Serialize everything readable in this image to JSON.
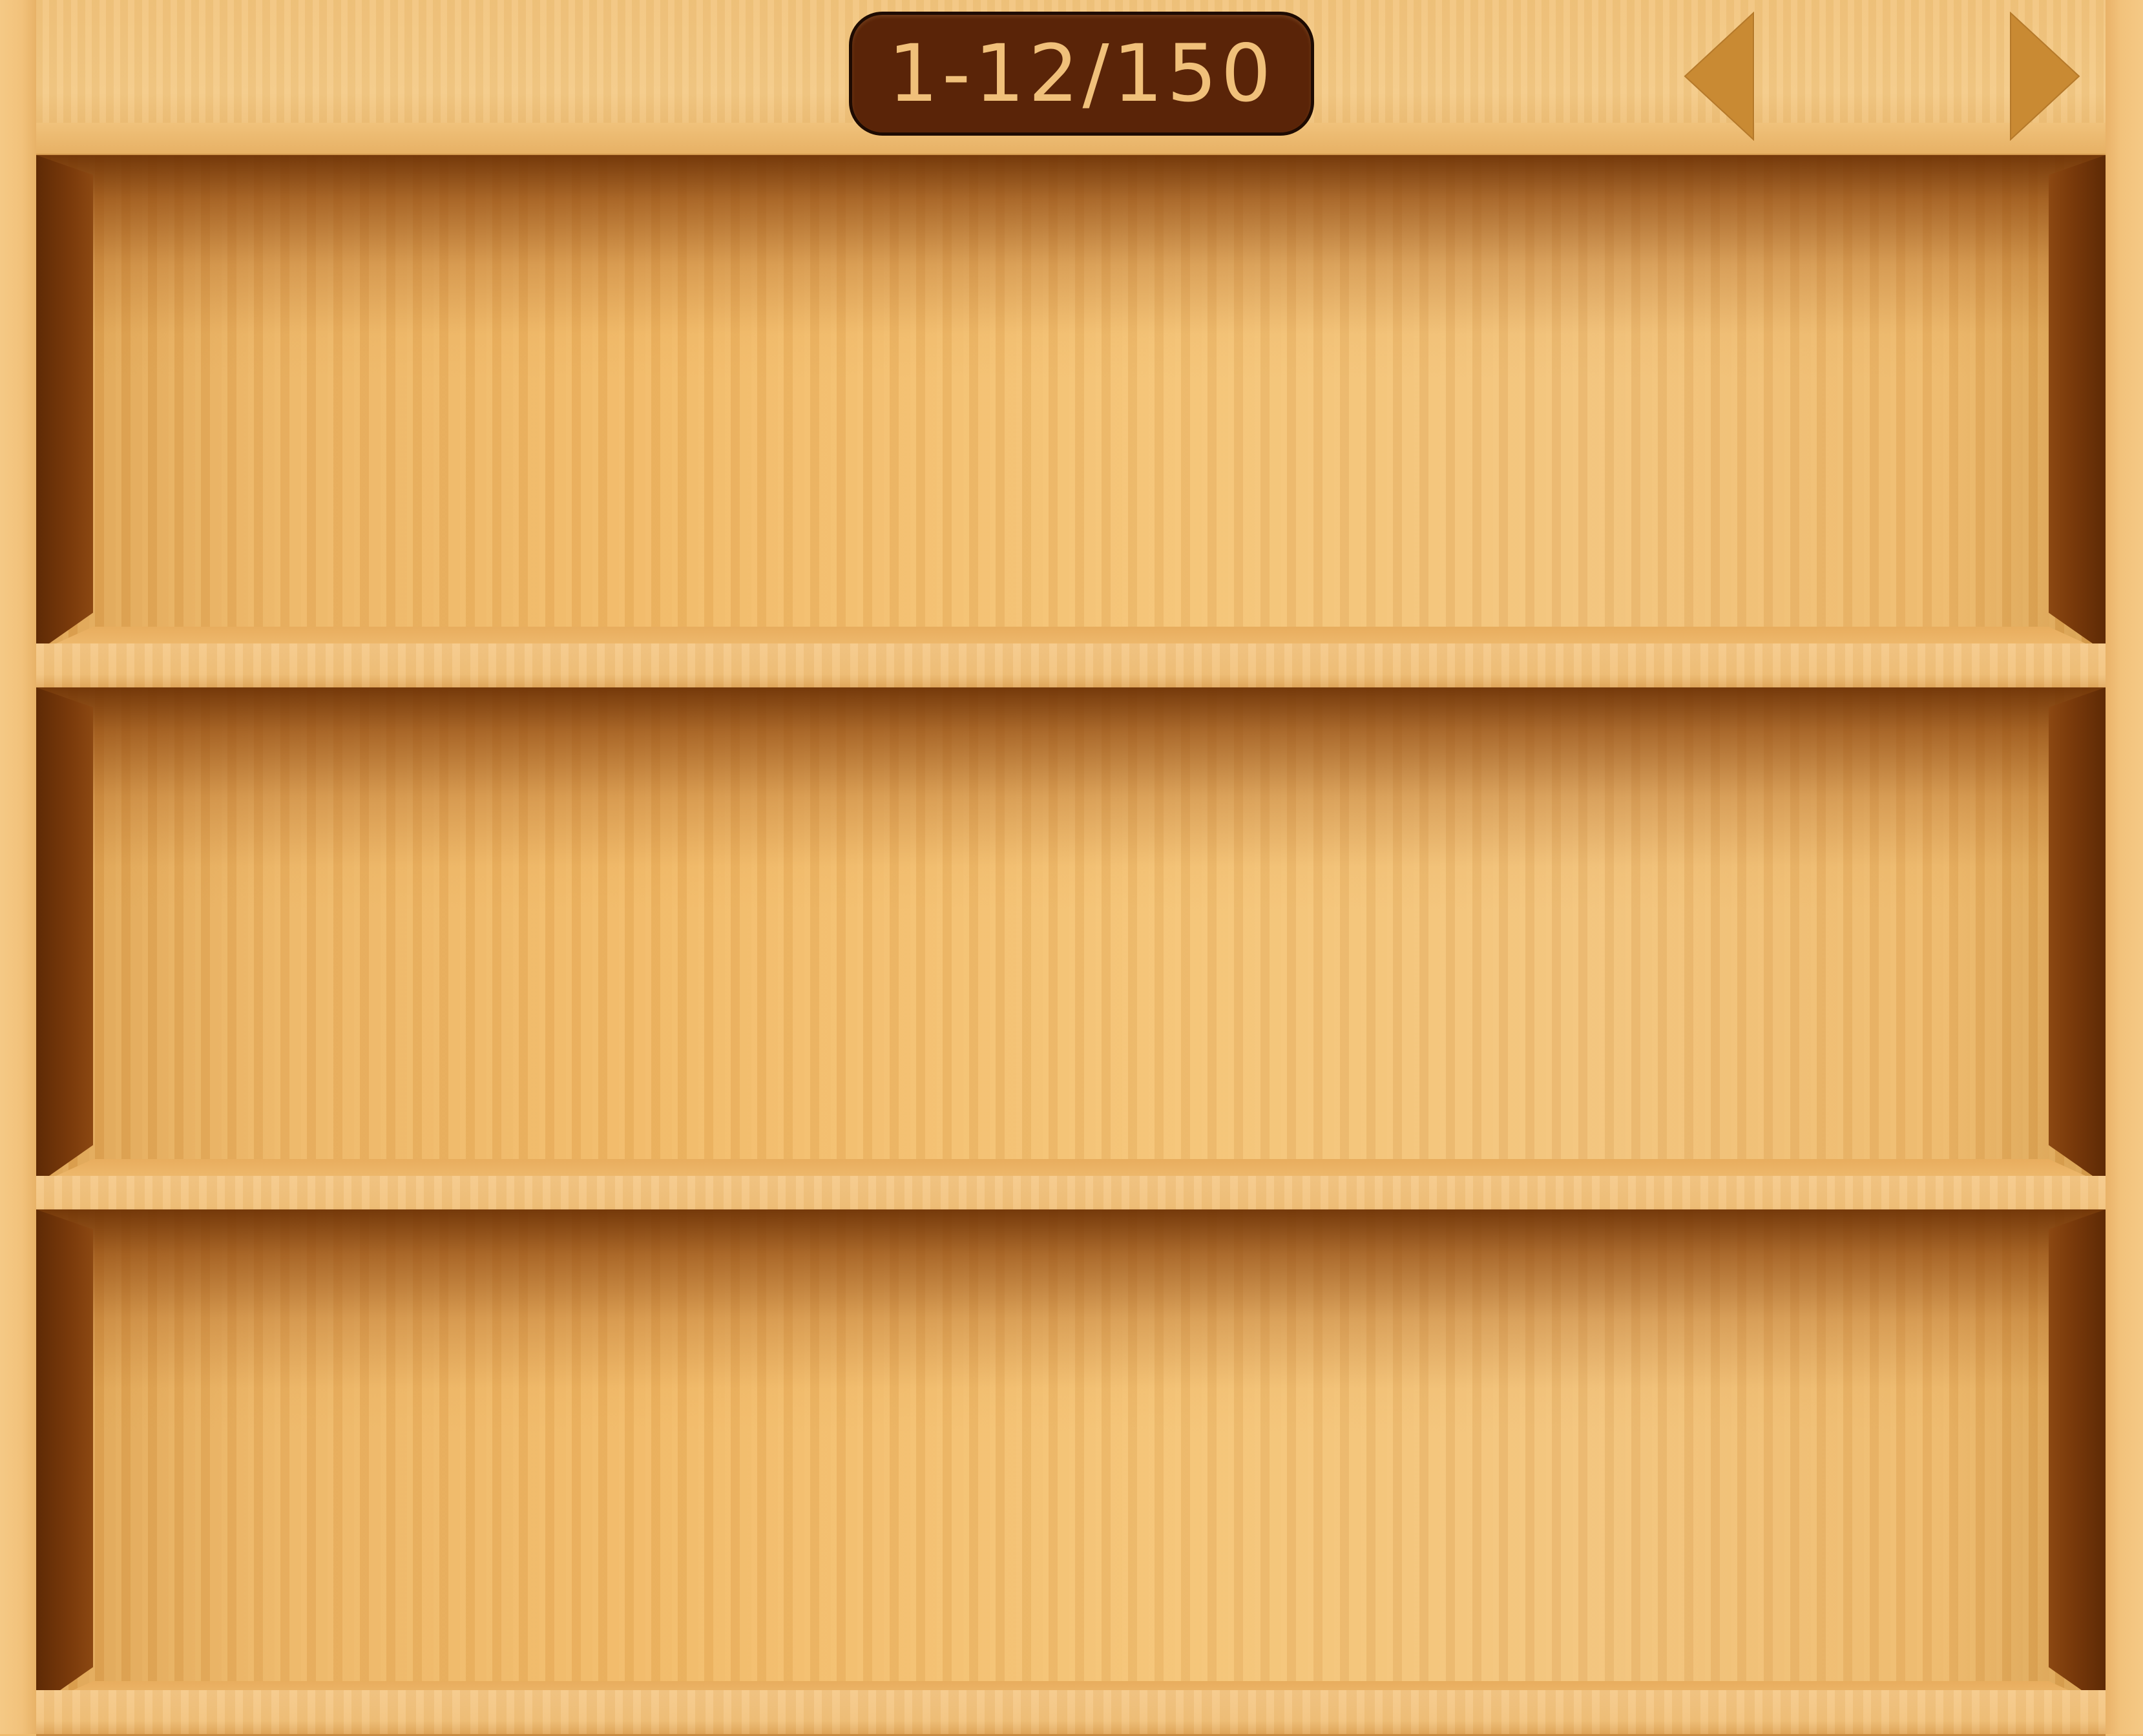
{
  "header": {
    "page_counter": "1-12/150"
  },
  "navigation": {
    "prev_icon": "triangle-left-icon",
    "next_icon": "triangle-right-icon",
    "arrow_color": "#c98a33"
  },
  "theme": {
    "wood_light": "#f2c27b",
    "wood_dark": "#5e2a05",
    "badge_background": "#5a2408",
    "badge_text": "#f0c07a"
  }
}
